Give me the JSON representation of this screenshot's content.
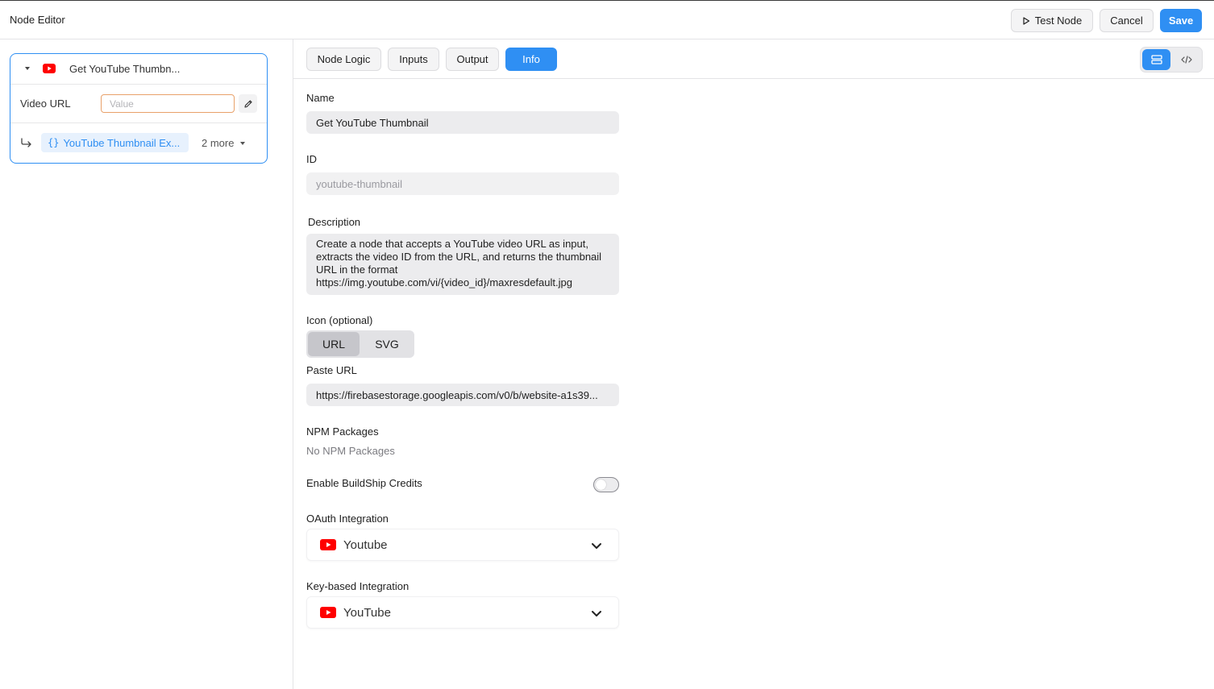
{
  "header": {
    "title": "Node Editor",
    "test_label": "Test Node",
    "cancel_label": "Cancel",
    "save_label": "Save"
  },
  "node_card": {
    "title": "Get YouTube Thumbn...",
    "input_label": "Video URL",
    "input_placeholder": "Value",
    "output_chip": "YouTube Thumbnail Ex...",
    "output_brace": "{}",
    "more_label": "2 more"
  },
  "tabs": [
    "Node Logic",
    "Inputs",
    "Output",
    "Info"
  ],
  "active_tab": "Info",
  "info": {
    "name_label": "Name",
    "name_value": "Get YouTube Thumbnail",
    "id_label": "ID",
    "id_placeholder": "youtube-thumbnail",
    "description_label": "Description",
    "description_value": "Create a node that accepts a YouTube video URL as input,\nextracts the video ID from the URL, and returns the thumbnail\nURL in the format\nhttps://img.youtube.com/vi/{video_id}/maxresdefault.jpg",
    "icon_label": "Icon (optional)",
    "icon_options": [
      "URL",
      "SVG"
    ],
    "icon_selected": "URL",
    "paste_url_label": "Paste URL",
    "paste_url_value": "https://firebasestorage.googleapis.com/v0/b/website-a1s39...",
    "npm_label": "NPM Packages",
    "npm_empty": "No NPM Packages",
    "credits_label": "Enable BuildShip Credits",
    "credits_enabled": false,
    "oauth_label": "OAuth Integration",
    "oauth_value": "Youtube",
    "key_label": "Key-based Integration",
    "key_value": "YouTube"
  },
  "colors": {
    "accent": "#2f8ff3",
    "youtube_red": "#ff0000",
    "input_border": "#e8a16a"
  },
  "icons": [
    "play-icon",
    "youtube-icon",
    "pencil-icon",
    "return-arrow-icon",
    "list-view-icon",
    "code-view-icon",
    "chevron-down-icon"
  ]
}
